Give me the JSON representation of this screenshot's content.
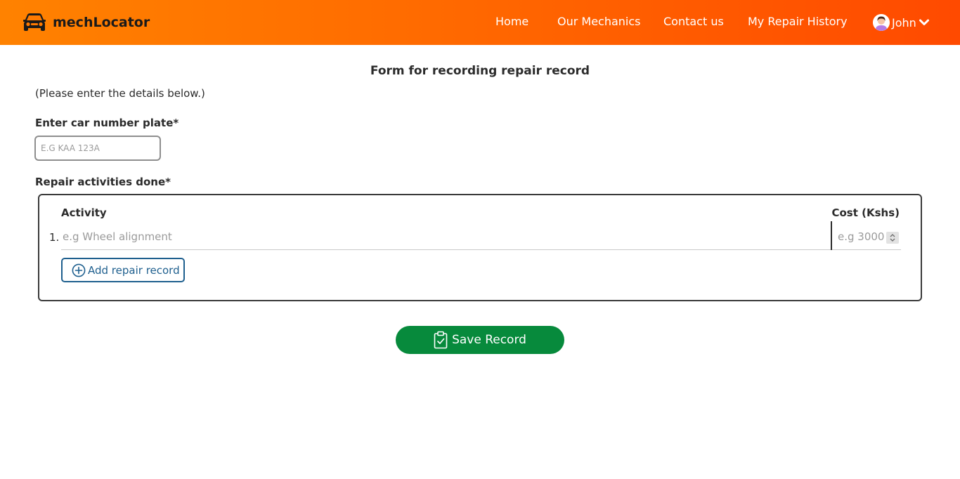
{
  "navbar": {
    "brand": "mechLocator",
    "brand_icon": "car-front-icon",
    "links": {
      "home": "Home",
      "mechanics": "Our Mechanics",
      "contact": "Contact us",
      "history": "My Repair History"
    },
    "user": {
      "name": "John",
      "avatar_icon": "user-avatar-icon",
      "dropdown_icon": "chevron-down-icon"
    },
    "gradient_colors": [
      "#ff8200",
      "#ff4a00"
    ]
  },
  "form": {
    "title": "Form for recording repair record",
    "instruction": "(Please enter the details below.)",
    "plate_label": "Enter car number plate*",
    "plate_placeholder": "E.G KAA 123A",
    "plate_value": "",
    "repairs_label": "Repair activities done*",
    "columns": {
      "activity": "Activity",
      "cost": "Cost (Kshs)"
    },
    "rows": [
      {
        "number": "1.",
        "activity_placeholder": "e.g Wheel alignment",
        "activity_value": "",
        "cost_placeholder": "e.g 3000",
        "cost_value": ""
      }
    ],
    "add_button": {
      "label": "Add repair record",
      "icon": "plus-circle-icon",
      "color": "#1e5f8e"
    },
    "save_button": {
      "label": "Save Record",
      "icon": "clipboard-check-icon",
      "color": "#078a3c"
    }
  }
}
